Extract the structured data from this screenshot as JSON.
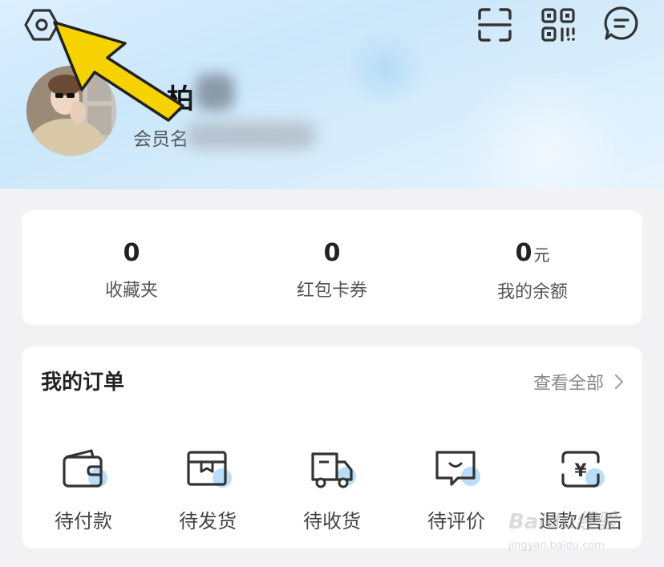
{
  "header": {
    "username_visible": "柏",
    "member_label": "会员名"
  },
  "stats": [
    {
      "value": "0",
      "unit": "",
      "label": "收藏夹"
    },
    {
      "value": "0",
      "unit": "",
      "label": "红包卡券"
    },
    {
      "value": "0",
      "unit": "元",
      "label": "我的余额"
    }
  ],
  "orders": {
    "title": "我的订单",
    "view_all": "查看全部",
    "items": [
      {
        "label": "待付款",
        "icon": "wallet-icon"
      },
      {
        "label": "待发货",
        "icon": "package-icon"
      },
      {
        "label": "待收货",
        "icon": "truck-icon"
      },
      {
        "label": "待评价",
        "icon": "comment-icon"
      },
      {
        "label": "退款/售后",
        "icon": "refund-icon"
      }
    ]
  },
  "watermark": {
    "line1": "Baidu经验",
    "line2": "jingyan.baidu.com"
  },
  "colors": {
    "header_bg": "#d6ecfb",
    "icon_accent": "#a9d6f5",
    "arrow": "#f5d000"
  }
}
